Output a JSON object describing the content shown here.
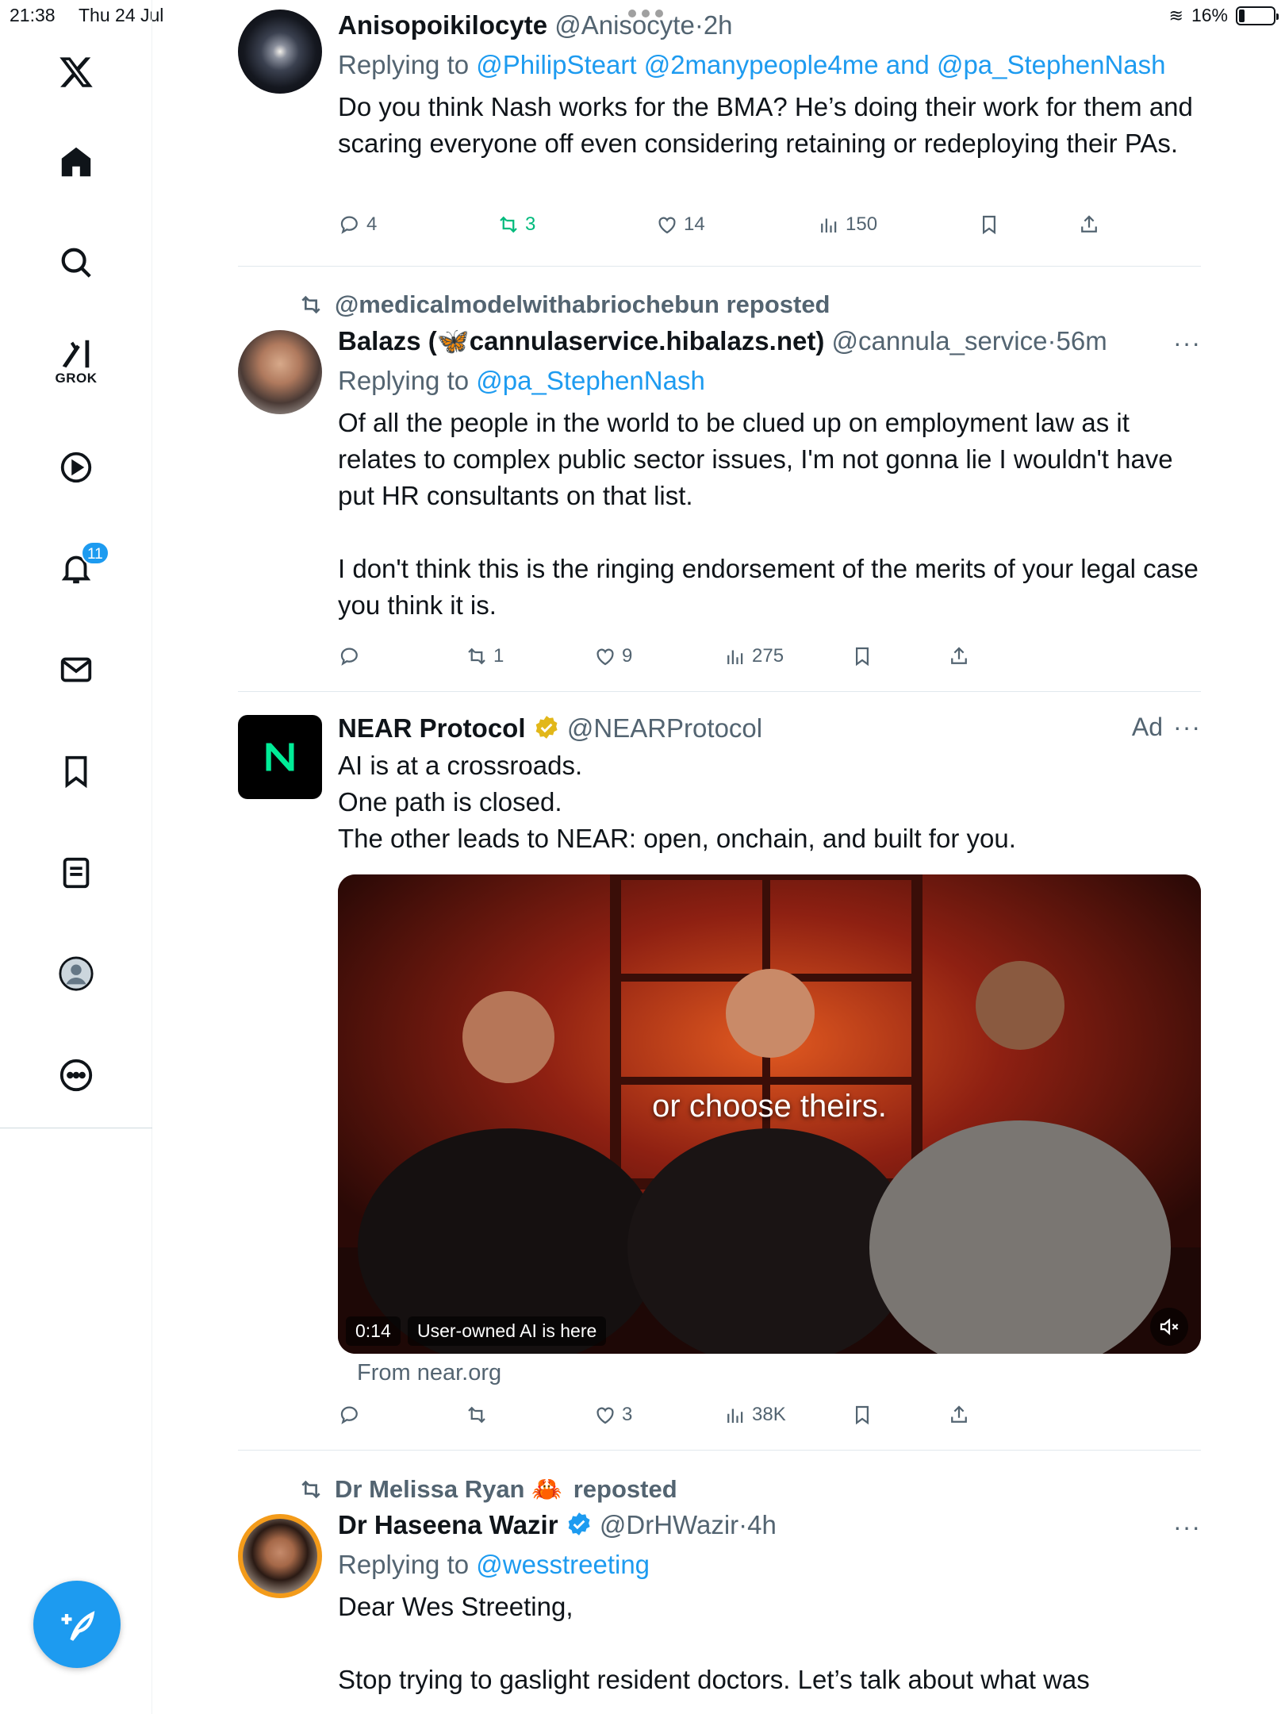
{
  "status_bar": {
    "time": "21:38",
    "date": "Thu 24 Jul",
    "battery": "16%",
    "battery_level": 0.16
  },
  "sidebar": {
    "grok_label": "GROK",
    "notifications_badge": "11",
    "items": [
      "home-icon",
      "search-icon",
      "grok-icon",
      "video-icon",
      "bell-icon",
      "mail-icon",
      "bookmark-icon",
      "lists-icon",
      "profile-icon",
      "more-icon"
    ],
    "compose_color": "#1d9bf0"
  },
  "tweets": [
    {
      "name": "Anisopoikilocyte",
      "handle": "@Anisocyte",
      "time": "2h",
      "replying_prefix": "Replying to",
      "replying_to": "@PhilipSteart @2manypeople4me and @pa_StephenNash",
      "text": "Do you think Nash works for the BMA? He’s doing their work for them and scaring everyone off even considering retaining or redeploying their PAs.",
      "replies": "4",
      "reposts": "3",
      "likes": "14",
      "views": "150"
    },
    {
      "reposted_by": "@medicalmodelwithabriochebun reposted",
      "name": "Balazs (🦋cannulaservice.hibalazs.net)",
      "handle": "@cannula_service",
      "time": "56m",
      "more": "···",
      "replying_prefix": "Replying to",
      "replying_to": "@pa_StephenNash",
      "text": "Of all the people in the world to be clued up on employment law as it relates to complex public sector issues, I'm not gonna lie I wouldn't have put HR consultants on that list.\n\nI don't think this is the ringing endorsement of the merits of your legal case you think it is.",
      "replies": "",
      "reposts": "1",
      "likes": "9",
      "views": "275"
    },
    {
      "name": "NEAR Protocol",
      "handle": "@NEARProtocol",
      "ad_label": "Ad",
      "more": "···",
      "text": "AI is at a crossroads.\nOne path is closed.\nThe other leads to NEAR: open, onchain, and built for you.",
      "video_caption": "or choose theirs.",
      "video_time": "0:14",
      "video_title": "User-owned AI is here",
      "source": "From near.org",
      "replies": "",
      "reposts": "",
      "likes": "3",
      "views": "38K"
    },
    {
      "reposted_by_name": "Dr Melissa Ryan 🦀",
      "reposted_suffix": "reposted",
      "name": "Dr Haseena Wazir",
      "handle": "@DrHWazir",
      "time": "4h",
      "more": "···",
      "replying_prefix": "Replying to",
      "replying_to": "@wesstreeting",
      "text": "Dear Wes Streeting,\n\nStop trying to gaslight resident doctors. Let’s talk about what was"
    }
  ],
  "colors": {
    "accent": "#1d9bf0",
    "repost_green": "#00ba7c",
    "secondary_text": "#536471"
  }
}
